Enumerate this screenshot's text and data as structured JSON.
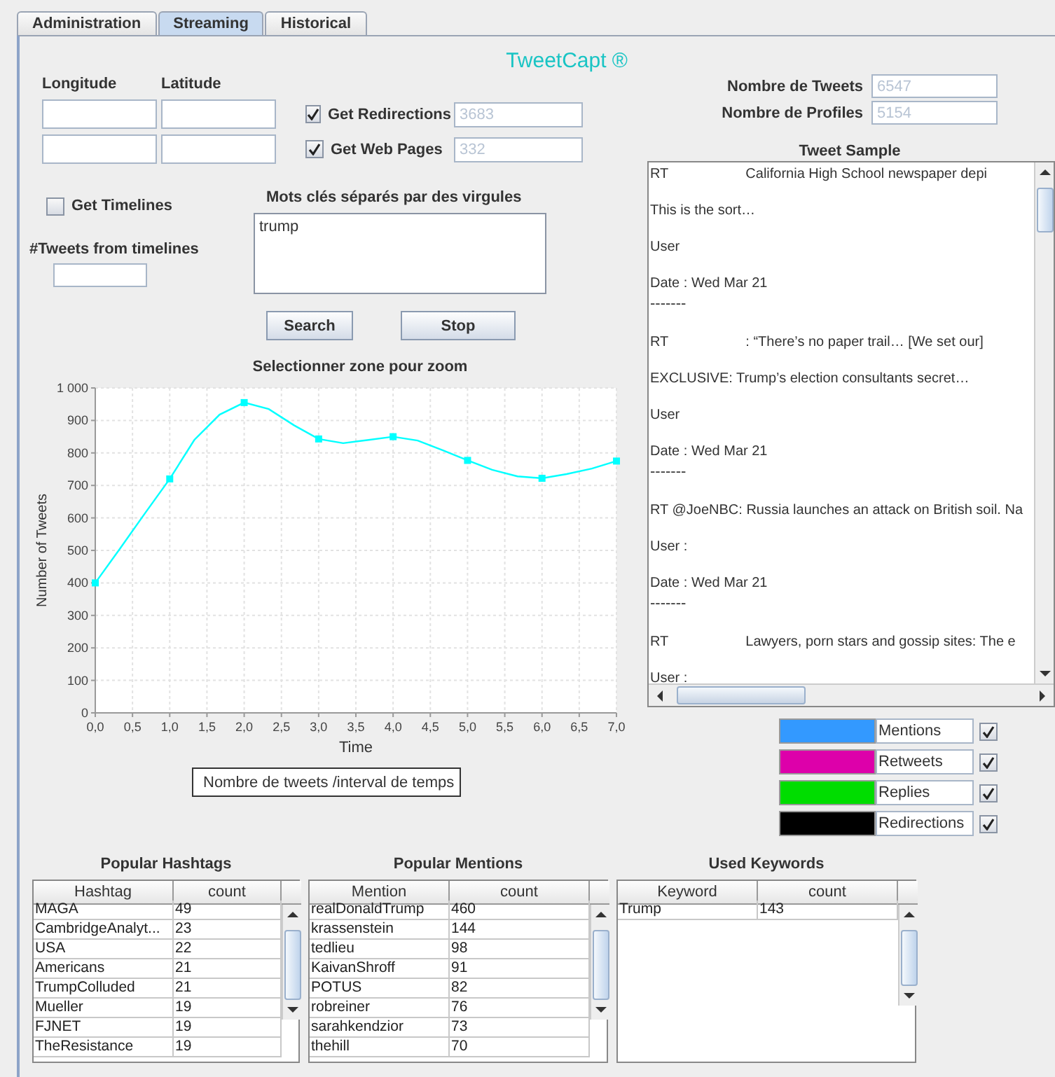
{
  "tabs": [
    {
      "label": "Administration",
      "selected": false
    },
    {
      "label": "Streaming",
      "selected": true
    },
    {
      "label": "Historical",
      "selected": false
    }
  ],
  "app_title": "TweetCapt ®",
  "location": {
    "longitude_label": "Longitude",
    "latitude_label": "Latitude"
  },
  "options": [
    {
      "label": "Get Redirections",
      "checked": true,
      "count": "3683"
    },
    {
      "label": "Get Web Pages",
      "checked": true,
      "count": "332"
    }
  ],
  "timelines": {
    "label": "Get Timelines",
    "checked": false,
    "count_label": "#Tweets from timelines"
  },
  "keywords": {
    "label": "Mots clés séparés par des virgules",
    "value": "trump"
  },
  "buttons": [
    "Search",
    "Stop"
  ],
  "stats": [
    {
      "label": "Nombre de Tweets",
      "value": "6547"
    },
    {
      "label": "Nombre de Profiles",
      "value": "5154"
    }
  ],
  "chart": {
    "title": "Selectionner zone pour zoom",
    "chart_data": {
      "type": "line",
      "grid": true,
      "xlabel": "Time",
      "ylabel": "Number of Tweets",
      "xlim": [
        0,
        7
      ],
      "ylim": [
        0,
        1000
      ],
      "xticks": [
        {
          "value": 0,
          "label": "0,0"
        },
        {
          "value": 0.5,
          "label": "0,5"
        },
        {
          "value": 1,
          "label": "1,0"
        },
        {
          "value": 1.5,
          "label": "1,5"
        },
        {
          "value": 2,
          "label": "2,0"
        },
        {
          "value": 2.5,
          "label": "2,5"
        },
        {
          "value": 3,
          "label": "3,0"
        },
        {
          "value": 3.5,
          "label": "3,5"
        },
        {
          "value": 4,
          "label": "4,0"
        },
        {
          "value": 4.5,
          "label": "4,5"
        },
        {
          "value": 5,
          "label": "5,0"
        },
        {
          "value": 5.5,
          "label": "5,5"
        },
        {
          "value": 6,
          "label": "6,0"
        },
        {
          "value": 6.5,
          "label": "6,5"
        },
        {
          "value": 7,
          "label": "7,0"
        }
      ],
      "yticks": [
        0,
        100,
        200,
        300,
        400,
        500,
        600,
        700,
        800,
        900,
        {
          "value": 1000,
          "label": "1 000"
        }
      ],
      "x": [
        0,
        0.33,
        0.67,
        1,
        1.33,
        1.67,
        2,
        2.33,
        2.67,
        3,
        3.33,
        3.67,
        4,
        4.33,
        4.67,
        5,
        5.33,
        5.67,
        6,
        6.33,
        6.67,
        7
      ],
      "series": [
        {
          "name": "Nombre de tweets /interval de temps",
          "color": "#00ffff",
          "values": [
            400,
            505,
            615,
            720,
            840,
            918,
            955,
            935,
            885,
            843,
            830,
            840,
            850,
            838,
            808,
            777,
            748,
            728,
            722,
            735,
            752,
            775
          ]
        }
      ]
    }
  },
  "tweet_sample": {
    "title": "Tweet Sample",
    "tweets": [
      {
        "rt": "RT",
        "headline": "California High School newspaper depi",
        "summary": "This is the sort…",
        "user": "User",
        "date": "Date : Wed Mar 21",
        "separator": "-------"
      },
      {
        "rt": "RT",
        "headline": ": “There’s no paper trail… [We set our]",
        "summary": "EXCLUSIVE: Trump’s election consultants secret…",
        "user": "User",
        "date": "Date : Wed Mar 21",
        "separator": "-------"
      },
      {
        "headline": "RT @JoeNBC: Russia launches an attack on British soil. Na",
        "user": "User :",
        "date": "Date : Wed Mar 21",
        "separator": "-------"
      },
      {
        "rt": "RT",
        "headline": "Lawyers, porn stars and gossip sites: The e",
        "user": "User :"
      }
    ]
  },
  "series_legend": [
    {
      "label": "Mentions",
      "color": "#3399ff",
      "checked": true
    },
    {
      "label": "Retweets",
      "color": "#dd00aa",
      "checked": true
    },
    {
      "label": "Replies",
      "color": "#00dd00",
      "checked": true
    },
    {
      "label": "Redirections",
      "color": "#000000",
      "checked": true
    }
  ],
  "tables": [
    {
      "title": "Popular Hashtags",
      "columns": [
        "Hashtag",
        "count"
      ],
      "rows": [
        [
          "MAGA",
          "49"
        ],
        [
          "CambridgeAnalyt...",
          "23"
        ],
        [
          "USA",
          "22"
        ],
        [
          "Americans",
          "21"
        ],
        [
          "TrumpColluded",
          "21"
        ],
        [
          "Mueller",
          "19"
        ],
        [
          "FJNET",
          "19"
        ],
        [
          "TheResistance",
          "19"
        ]
      ]
    },
    {
      "title": "Popular Mentions",
      "columns": [
        "Mention",
        "count"
      ],
      "rows": [
        [
          "realDonaldTrump",
          "460"
        ],
        [
          "krassenstein",
          "144"
        ],
        [
          "tedlieu",
          "98"
        ],
        [
          "KaivanShroff",
          "91"
        ],
        [
          "POTUS",
          "82"
        ],
        [
          "robreiner",
          "76"
        ],
        [
          "sarahkendzior",
          "73"
        ],
        [
          "thehill",
          "70"
        ]
      ]
    },
    {
      "title": "Used Keywords",
      "columns": [
        "Keyword",
        "count"
      ],
      "rows": [
        [
          "Trump",
          "143"
        ]
      ]
    }
  ]
}
